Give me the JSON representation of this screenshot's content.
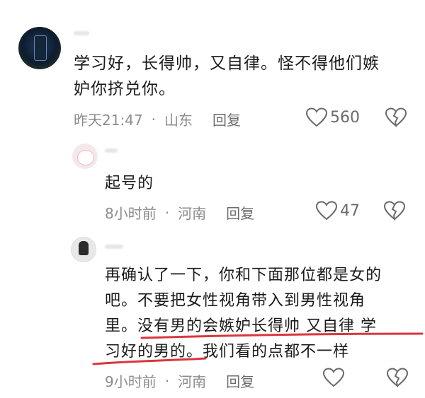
{
  "comments": [
    {
      "text_lines": [
        "学习好，长得帅，又自律。怪不得他们嫉",
        "妒你挤兑你。"
      ],
      "time": "昨天21:47",
      "location": "山东",
      "reply_label": "回复",
      "likes": "560"
    },
    {
      "text_lines": [
        "起号的"
      ],
      "time": "8小时前",
      "location": "河南",
      "reply_label": "回复",
      "likes": "47"
    },
    {
      "text_lines": [
        "再确认了一下，你和下面那位都是女的",
        "吧。不要把女性视角带入到男性视角",
        "里。没有男的会嫉妒长得帅 又自律 学",
        "习好的男的。我们看的点都不一样"
      ],
      "time": "9小时前",
      "location": "河南",
      "reply_label": "回复",
      "likes": ""
    }
  ],
  "meta_separator": "·",
  "colors": {
    "meta_text": "#8c8c8c",
    "annotation_red": "#d9363e",
    "text": "#1a1a1a"
  },
  "icons": [
    "heart-icon",
    "broken-heart-icon"
  ]
}
